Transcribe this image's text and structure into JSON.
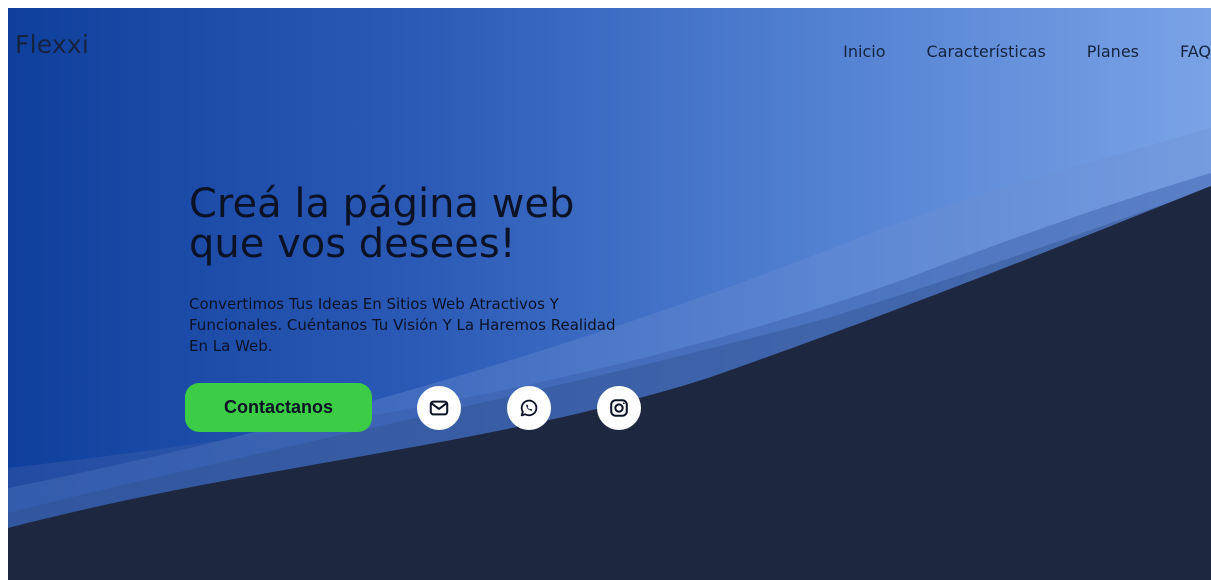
{
  "brand": {
    "logo": "Flexxi"
  },
  "nav": {
    "items": [
      {
        "label": "Inicio"
      },
      {
        "label": "Características"
      },
      {
        "label": "Planes"
      },
      {
        "label": "FAQ"
      }
    ]
  },
  "hero": {
    "headline_line1": "Creá la página web",
    "headline_line2": "que vos desees!",
    "subtext": "Convertimos Tus Ideas En Sitios Web Atractivos Y Funcionales. Cuéntanos Tu Visión Y La Haremos Realidad En La Web.",
    "cta_label": "Contactanos"
  },
  "social": [
    {
      "icon": "mail-icon"
    },
    {
      "icon": "whatsapp-icon"
    },
    {
      "icon": "instagram-icon"
    }
  ],
  "colors": {
    "gradient_start": "#0f3f9c",
    "gradient_end": "#7aa3e6",
    "dark_section": "#1e2740",
    "cta_green": "#3ccc45",
    "text_dark": "#0b1226"
  }
}
